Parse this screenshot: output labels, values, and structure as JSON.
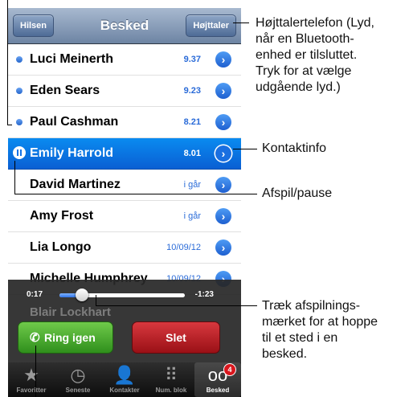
{
  "navbar": {
    "left_button": "Hilsen",
    "title": "Besked",
    "right_button": "Højttaler"
  },
  "messages": [
    {
      "name": "Luci Meinerth",
      "time": "9.37",
      "unread": true
    },
    {
      "name": "Eden Sears",
      "time": "9.23",
      "unread": true
    },
    {
      "name": "Paul Cashman",
      "time": "8.21",
      "unread": true
    },
    {
      "name": "Emily Harrold",
      "time": "8.01",
      "selected": true
    },
    {
      "name": "David Martinez",
      "time": "i går"
    },
    {
      "name": "Amy Frost",
      "time": "i går"
    },
    {
      "name": "Lia Longo",
      "time": "10/09/12"
    },
    {
      "name": "Michelle Humphrey",
      "time": "10/09/12"
    }
  ],
  "playback": {
    "elapsed": "0:17",
    "remaining": "-1:23",
    "progress": 0.18,
    "hidden_row_name": "Blair Lockhart",
    "call_button": "Ring igen",
    "delete_button": "Slet"
  },
  "tabbar": {
    "tabs": [
      {
        "label": "Favoritter",
        "icon": "star-icon"
      },
      {
        "label": "Seneste",
        "icon": "clock-icon"
      },
      {
        "label": "Kontakter",
        "icon": "person-icon"
      },
      {
        "label": "Num. blok",
        "icon": "keypad-icon"
      },
      {
        "label": "Besked",
        "icon": "voicemail-icon",
        "badge": "4",
        "active": true
      }
    ]
  },
  "callouts": {
    "speaker": "Højttalertelefon (Lyd,\nnår en Bluetooth-\nenhed er tilsluttet.\nTryk for at vælge\nudgående lyd.)",
    "contact_info": "Kontaktinfo",
    "play_pause": "Afspil/pause",
    "scrub": "Træk afspilnings-\nmærket for at hoppe\ntil et sted i en\nbesked."
  },
  "colors": {
    "accent_blue": "#2a6bd8",
    "call_green": "#3a9c25",
    "delete_red": "#c0242a",
    "badge_red": "#d9161d"
  }
}
